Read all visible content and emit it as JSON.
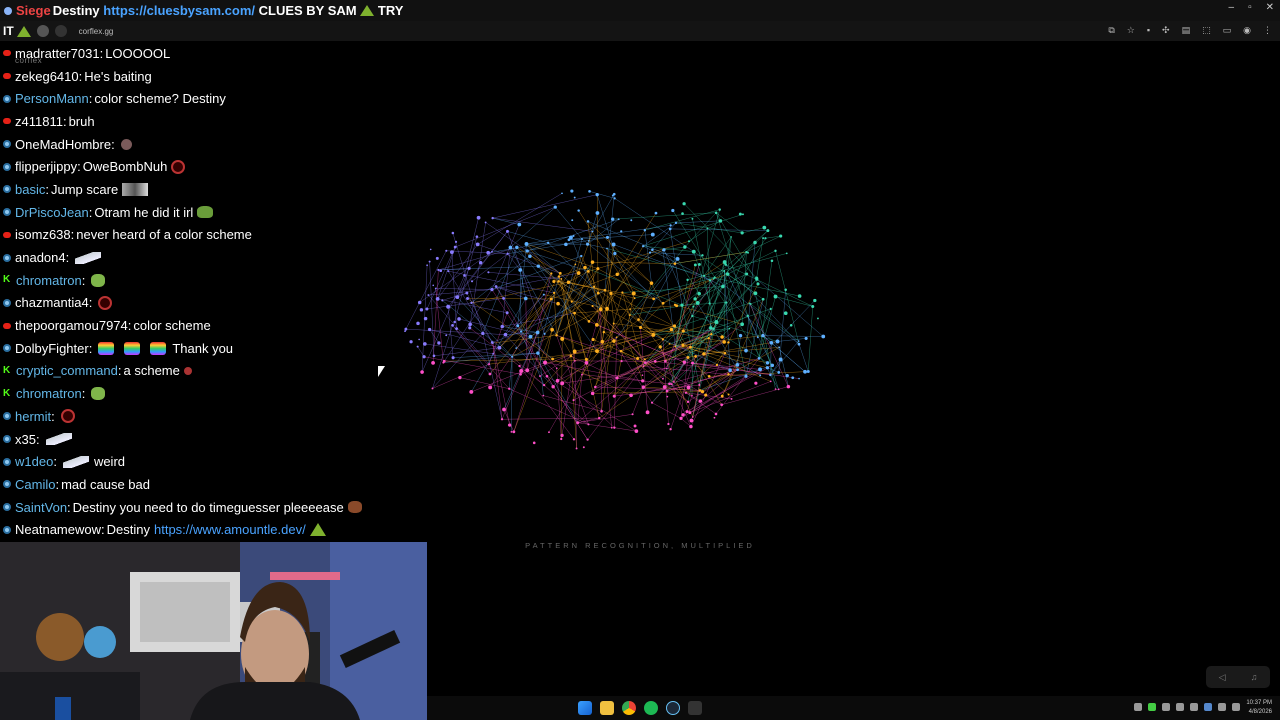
{
  "titlebar": {
    "overlay_text": "Siege",
    "message_user": "Destiny",
    "message_link": "https://cluesbysam.com/",
    "message_rest": "CLUES BY SAM",
    "message_tail": "TRY",
    "controls": [
      "–",
      "▫",
      "✕"
    ]
  },
  "browser": {
    "tab_text": "IT",
    "url": "corflex.gg",
    "watermark": "corflex"
  },
  "chat": [
    {
      "platform": "youtube",
      "user": "madratter7031",
      "user_color": "white",
      "text": "LOOOOOL",
      "emote": ""
    },
    {
      "platform": "youtube",
      "user": "zekeg6410",
      "user_color": "white",
      "text": "He's baiting",
      "emote": ""
    },
    {
      "platform": "twitch",
      "user": "PersonMann",
      "user_color": "blue",
      "text": "color scheme? Destiny",
      "emote": ""
    },
    {
      "platform": "youtube",
      "user": "z411811",
      "user_color": "white",
      "text": "bruh",
      "emote": ""
    },
    {
      "platform": "twitch",
      "user": "OneMadHombre",
      "user_color": "white",
      "text": "",
      "emote": "face"
    },
    {
      "platform": "twitch",
      "user": "flipperjippy",
      "user_color": "white",
      "text": "OweBombNuh",
      "emote": "ring"
    },
    {
      "platform": "twitch",
      "user": "basic",
      "user_color": "blue",
      "text": "Jump scare",
      "emote": "img"
    },
    {
      "platform": "twitch",
      "user": "DrPiscoJean",
      "user_color": "blue",
      "text": "Otram he did it irl",
      "emote": "frog"
    },
    {
      "platform": "youtube",
      "user": "isomz638",
      "user_color": "white",
      "text": "never heard of a color scheme",
      "emote": ""
    },
    {
      "platform": "twitch",
      "user": "anadon4",
      "user_color": "white",
      "text": "",
      "emote": "shark"
    },
    {
      "platform": "kick",
      "user": "chromatron",
      "user_color": "blue",
      "text": "",
      "emote": "blob"
    },
    {
      "platform": "twitch",
      "user": "chazmantia4",
      "user_color": "white",
      "text": "",
      "emote": "ring"
    },
    {
      "platform": "youtube",
      "user": "thepoorgamou7974",
      "user_color": "white",
      "text": "color scheme",
      "emote": ""
    },
    {
      "platform": "twitch",
      "user": "DolbyFighter",
      "user_color": "white",
      "text": "Thank you",
      "emote": "rainbow3"
    },
    {
      "platform": "kick",
      "user": "cryptic_command",
      "user_color": "blue",
      "text": "a scheme",
      "emote": "dot"
    },
    {
      "platform": "kick",
      "user": "chromatron",
      "user_color": "blue",
      "text": "",
      "emote": "blob"
    },
    {
      "platform": "twitch",
      "user": "hermit",
      "user_color": "blue",
      "text": "",
      "emote": "ring"
    },
    {
      "platform": "twitch",
      "user": "x35",
      "user_color": "white",
      "text": "",
      "emote": "shark"
    },
    {
      "platform": "twitch",
      "user": "w1deo",
      "user_color": "blue",
      "text": "weird",
      "emote": "shark-before"
    },
    {
      "platform": "twitch",
      "user": "Camilo",
      "user_color": "blue",
      "text": "mad cause bad",
      "emote": ""
    },
    {
      "platform": "twitch",
      "user": "SaintVon",
      "user_color": "blue",
      "text": "Destiny you need to do timeguesser pleeeease",
      "emote": "bear"
    },
    {
      "platform": "twitch",
      "user": "Neatnamewow",
      "user_color": "white",
      "text": "Destiny",
      "link": "https://www.amountle.dev/",
      "emote": "tri"
    }
  ],
  "center": {
    "tagline": "PATTERN RECOGNITION, MULTIPLIED",
    "palette": [
      "#8a7cff",
      "#39d9b0",
      "#ffb020",
      "#ff4fc8",
      "#5fb0ff"
    ]
  },
  "taskbar": {
    "apps": [
      "windows-start",
      "file-explorer",
      "chrome",
      "spotify",
      "steam",
      "game"
    ],
    "clock_time": "10:37 PM",
    "clock_date": "4/8/2026"
  }
}
